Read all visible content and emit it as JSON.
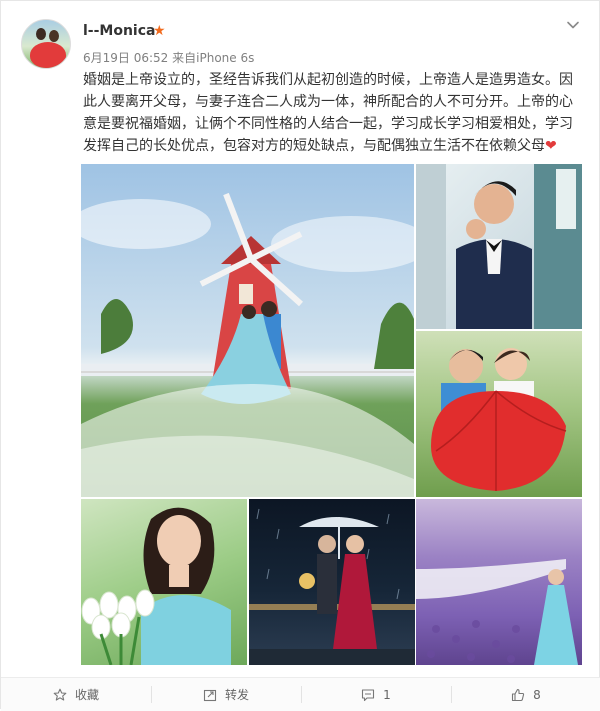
{
  "post": {
    "username": "l--Monica",
    "vip_badge": "★",
    "time": "6月19日 06:52",
    "source_prefix": "来自",
    "source": "iPhone 6s",
    "text": "婚姻是上帝设立的，圣经告诉我们从起初创造的时候，上帝造人是造男造女。因此人要离开父母，与妻子连合二人成为一体，神所配合的人不可分开。上帝的心意是要祝福婚姻，让俩个不同性格的人结合一起，学习成长学习相爱相处，学习发挥自己的长处优点，包容对方的短处缺点，与配偶独立生活不在依赖父母",
    "heart_emoji": "❤"
  },
  "footer": {
    "favorite_label": "收藏",
    "repost_label": "转发",
    "comment_count": "1",
    "like_count": "8"
  },
  "colors": {
    "accent_orange": "#f26b1d",
    "heart_red": "#e23b3b",
    "meta_gray": "#808080"
  }
}
